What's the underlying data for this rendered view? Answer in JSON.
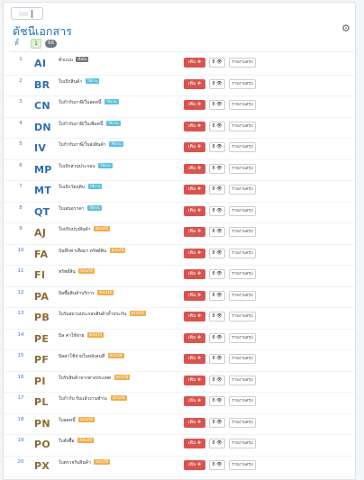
{
  "header": {
    "title": "ดัชนีเอกสาร",
    "gear_icon": "gear-icon"
  },
  "tabs": {
    "all_label": "ทั้",
    "count_a": "1",
    "count_b": "66"
  },
  "colors": {
    "title_blue": "#1e6fb8",
    "code_blue": "#2d6db5",
    "code_orange": "#8c6a35",
    "red_button": "#d9534f",
    "badge_gray": "#777777",
    "badge_blue": "#5bc0de",
    "badge_orange": "#f0ad4e"
  },
  "row_buttons": {
    "red_label": "เพิ่ม ✚",
    "eye_label": "8 👁",
    "detail_label": "รายงานสรุป"
  },
  "rows": [
    {
      "no": "1",
      "code": "AI",
      "name": "ทั่วเเบบ",
      "badge": "ตั้งต้น",
      "badge_color": "#777777",
      "code_color": "#2d6db5"
    },
    {
      "no": "2",
      "code": "BR",
      "name": "ใบเบิกสินค้า",
      "badge": "ใช้งาน",
      "badge_color": "#5bc0de",
      "code_color": "#2d6db5"
    },
    {
      "no": "3",
      "code": "CN",
      "name": "ใบกำกับภาษี/ใบลดหนี้",
      "badge": "ใช้งาน",
      "badge_color": "#5bc0de",
      "code_color": "#2d6db5"
    },
    {
      "no": "4",
      "code": "DN",
      "name": "ใบกำกับภาษี/ใบเพิ่มหนี้",
      "badge": "ใช้งาน",
      "badge_color": "#5bc0de",
      "code_color": "#2d6db5"
    },
    {
      "no": "5",
      "code": "IV",
      "name": "ใบกำกับภาษี/ใบส่งสินค้า",
      "badge": "ใช้งาน",
      "badge_color": "#5bc0de",
      "code_color": "#2d6db5"
    },
    {
      "no": "6",
      "code": "MP",
      "name": "ใบเบิกส่วนประกอบ",
      "badge": "ใช้งาน",
      "badge_color": "#5bc0de",
      "code_color": "#2d6db5"
    },
    {
      "no": "7",
      "code": "MT",
      "name": "ใบเบิกวัตถุดิบ",
      "badge": "ใช้งาน",
      "badge_color": "#5bc0de",
      "code_color": "#2d6db5"
    },
    {
      "no": "8",
      "code": "QT",
      "name": "ใบเสนอราคา",
      "badge": "ใช้งาน",
      "badge_color": "#5bc0de",
      "code_color": "#2d6db5"
    },
    {
      "no": "9",
      "code": "AJ",
      "name": "ใบปรับปรุงสินค้า",
      "badge": "ยังไม่ใช้",
      "badge_color": "#f0ad4e",
      "code_color": "#8c6a35"
    },
    {
      "no": "10",
      "code": "FA",
      "name": "บันทึกค่าเสื่อมฯ ทรัพย์สิน",
      "badge": "ยังไม่ใช้",
      "badge_color": "#f0ad4e",
      "code_color": "#8c6a35"
    },
    {
      "no": "11",
      "code": "FI",
      "name": "ทรัพย์สิน",
      "badge": "ยังไม่ใช้",
      "badge_color": "#f0ad4e",
      "code_color": "#8c6a35"
    },
    {
      "no": "12",
      "code": "PA",
      "name": "บิลซื้อสินค้าบริการ",
      "badge": "ยังไม่ใช้",
      "badge_color": "#f0ad4e",
      "code_color": "#8c6a35"
    },
    {
      "no": "13",
      "code": "PB",
      "name": "ใบรับสถานประกอบสินค้าค้ำประกัน",
      "badge": "ยังไม่ใช้",
      "badge_color": "#f0ad4e",
      "code_color": "#8c6a35"
    },
    {
      "no": "14",
      "code": "PE",
      "name": "บิล ค่าใช้จ่าย",
      "badge": "ยังไม่ใช้",
      "badge_color": "#f0ad4e",
      "code_color": "#8c6a35"
    },
    {
      "no": "15",
      "code": "PF",
      "name": "บิลค่าใช้จ่ายในหลังอนที่",
      "badge": "ยังไม่ใช้",
      "badge_color": "#f0ad4e",
      "code_color": "#8c6a35"
    },
    {
      "no": "16",
      "code": "PI",
      "name": "ใบรับสินค้าจากต่างประเทศ",
      "badge": "ยังไม่ใช้",
      "badge_color": "#f0ad4e",
      "code_color": "#8c6a35"
    },
    {
      "no": "17",
      "code": "PL",
      "name": "ใบกำกับ รับแล้วงานชำระ",
      "badge": "ยังไม่ใช้",
      "badge_color": "#f0ad4e",
      "code_color": "#8c6a35"
    },
    {
      "no": "18",
      "code": "PN",
      "name": "ใบลดหนี้",
      "badge": "ยังไม่ใช้",
      "badge_color": "#f0ad4e",
      "code_color": "#8c6a35"
    },
    {
      "no": "19",
      "code": "PO",
      "name": "ใบสั่งซื้อ",
      "badge": "ยังไม่ใช้",
      "badge_color": "#f0ad4e",
      "code_color": "#8c6a35"
    },
    {
      "no": "20",
      "code": "PX",
      "name": "ใบตรวจรับสินค้า",
      "badge": "ยังไม่ใช้",
      "badge_color": "#f0ad4e",
      "code_color": "#8c6a35"
    }
  ]
}
